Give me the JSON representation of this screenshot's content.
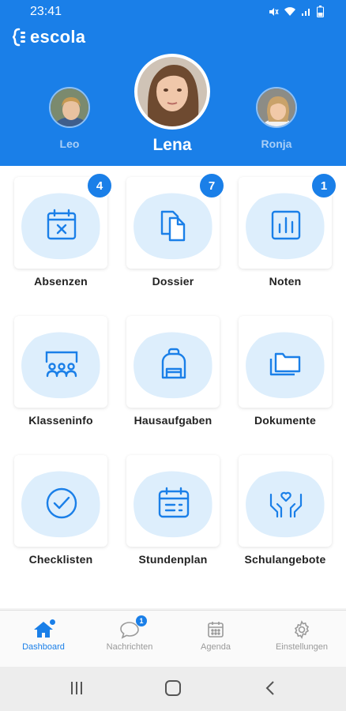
{
  "status_bar": {
    "time": "23:41"
  },
  "app": {
    "logo_text": "escola",
    "brand_color": "#1a7fe8"
  },
  "students": [
    {
      "name": "Leo",
      "active": false
    },
    {
      "name": "Lena",
      "active": true
    },
    {
      "name": "Ronja",
      "active": false
    }
  ],
  "tiles": [
    {
      "label": "Absenzen",
      "icon": "calendar-x-icon",
      "badge": "4"
    },
    {
      "label": "Dossier",
      "icon": "documents-icon",
      "badge": "7"
    },
    {
      "label": "Noten",
      "icon": "bar-chart-icon",
      "badge": "1"
    },
    {
      "label": "Klasseninfo",
      "icon": "classroom-icon",
      "badge": null
    },
    {
      "label": "Hausaufgaben",
      "icon": "backpack-icon",
      "badge": null
    },
    {
      "label": "Dokumente",
      "icon": "folder-icon",
      "badge": null
    },
    {
      "label": "Checklisten",
      "icon": "check-circle-icon",
      "badge": null
    },
    {
      "label": "Stundenplan",
      "icon": "timetable-icon",
      "badge": null
    },
    {
      "label": "Schulangebote",
      "icon": "hands-heart-icon",
      "badge": null
    }
  ],
  "bottom_nav": [
    {
      "label": "Dashboard",
      "icon": "home-icon",
      "active": true
    },
    {
      "label": "Nachrichten",
      "icon": "chat-icon",
      "active": false,
      "count": "1"
    },
    {
      "label": "Agenda",
      "icon": "calendar-icon",
      "active": false
    },
    {
      "label": "Einstellungen",
      "icon": "gear-icon",
      "active": false
    }
  ]
}
